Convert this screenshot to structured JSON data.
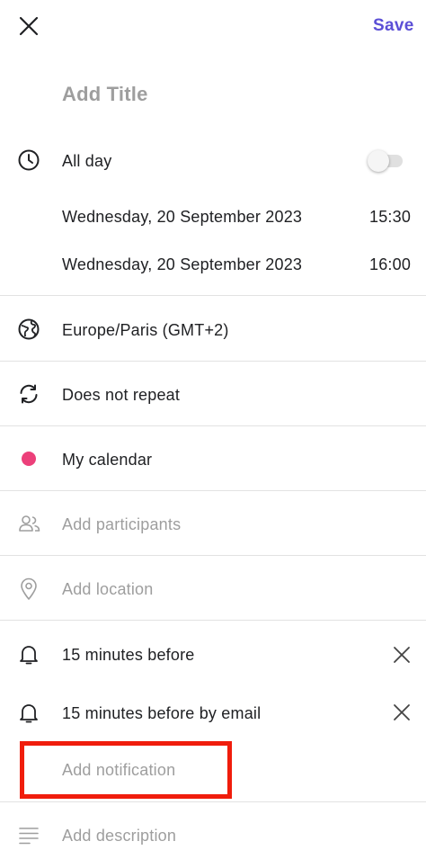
{
  "header": {
    "save_label": "Save",
    "title_placeholder": "Add Title"
  },
  "all_day": {
    "label": "All day",
    "enabled": false
  },
  "start": {
    "date": "Wednesday, 20 September 2023",
    "time": "15:30"
  },
  "end": {
    "date": "Wednesday, 20 September 2023",
    "time": "16:00"
  },
  "timezone": {
    "label": "Europe/Paris (GMT+2)"
  },
  "repeat": {
    "label": "Does not repeat"
  },
  "calendar": {
    "label": "My calendar",
    "color": "#ec407a"
  },
  "participants": {
    "placeholder": "Add participants"
  },
  "location": {
    "placeholder": "Add location"
  },
  "notifications": [
    {
      "label": "15 minutes before"
    },
    {
      "label": "15 minutes before by email"
    }
  ],
  "add_notification": {
    "label": "Add notification"
  },
  "description": {
    "placeholder": "Add description"
  },
  "colors": {
    "accent": "#5b4fd6",
    "highlight": "#f01d0c"
  }
}
